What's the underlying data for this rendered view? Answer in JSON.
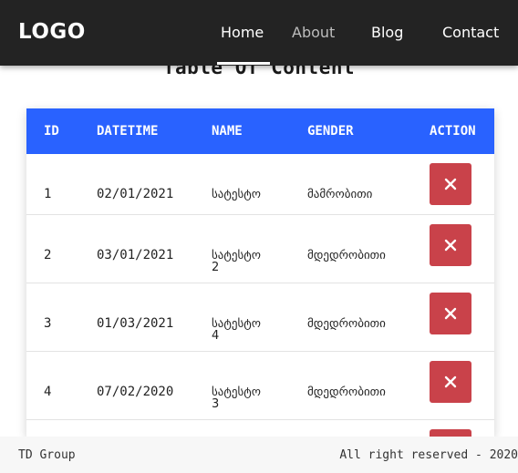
{
  "nav": {
    "logo": "LOGO",
    "links": [
      "Home",
      "About",
      "Blog",
      "Contact"
    ],
    "active": "Home"
  },
  "page": {
    "title": "Table Of Content"
  },
  "table": {
    "headers": [
      "ID",
      "DATETIME",
      "NAME",
      "GENDER",
      "ACTION"
    ],
    "rows": [
      {
        "id": "1",
        "datetime": "02/01/2021",
        "name_line1": "სატესტო",
        "name_line2": "",
        "gender": "მამრობითი"
      },
      {
        "id": "2",
        "datetime": "03/01/2021",
        "name_line1": "სატესტო",
        "name_line2": "2",
        "gender": "მდედრობითი"
      },
      {
        "id": "3",
        "datetime": "01/03/2021",
        "name_line1": "სატესტო",
        "name_line2": "4",
        "gender": "მდედრობითი"
      },
      {
        "id": "4",
        "datetime": "07/02/2020",
        "name_line1": "სატესტო",
        "name_line2": "3",
        "gender": "მდედრობითი"
      }
    ],
    "action_icon": "close-icon"
  },
  "footer": {
    "left": "TD Group",
    "right": "All right reserved - 2020"
  },
  "colors": {
    "navbar": "#232323",
    "header": "#2962ff",
    "delete": "#c9424a"
  }
}
